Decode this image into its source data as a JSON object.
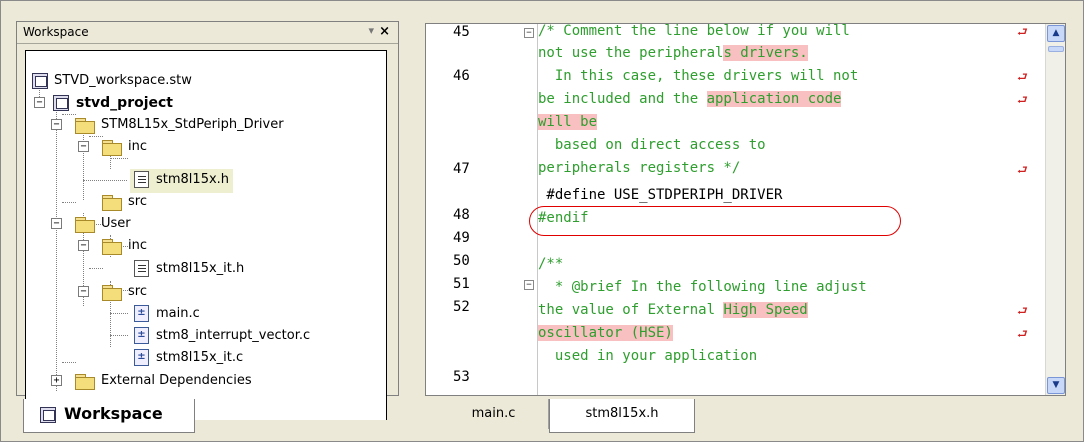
{
  "workspace_panel": {
    "title": "Workspace",
    "pin_glyph": "▾",
    "close_glyph": "×",
    "tab_label": "Workspace",
    "tree": {
      "workspace_file": "STVD_workspace.stw",
      "project": "stvd_project",
      "driver_folder": "STM8L15x_StdPeriph_Driver",
      "driver_inc": "inc",
      "driver_header": "stm8l15x.h",
      "driver_src": "src",
      "user_folder": "User",
      "user_inc": "inc",
      "user_header": "stm8l15x_it.h",
      "user_src": "src",
      "user_files": [
        "main.c",
        "stm8_interrupt_vector.c",
        "stm8l15x_it.c"
      ],
      "external_dependencies": "External Dependencies"
    }
  },
  "editor": {
    "line_numbers": [
      "45",
      "46",
      "47",
      "48",
      "49",
      "50",
      "51",
      "52",
      "53"
    ],
    "code": {
      "l45a_pre": "/* Comment the line below if you will",
      "l45b_pre": "not use the peripheral",
      "l45b_hl": "s drivers.",
      "l46a": "  In this case, these drivers will not",
      "l46b_pre": "be included and the ",
      "l46b_hl": "application code",
      "l46c_hl": "will be",
      "l47a": "  based on direct access to",
      "l47b": "peripherals registers */",
      "l48": " #define USE_STDPERIPH_DRIVER",
      "l49": "#endif",
      "l51": "/**",
      "l52a": "  * @brief In the following line adjust",
      "l52b_pre": "the value of External ",
      "l52b_hl": "High Speed",
      "l52c_hl": "oscillator (HSE)",
      "l53": "  used in your application"
    },
    "wrap_glyph": "⮐",
    "tabs": [
      "main.c",
      "stm8l15x.h"
    ],
    "active_tab": "stm8l15x.h"
  },
  "colors": {
    "comment": "#2e9e2e",
    "highlight": "#f8c0c0",
    "annotation_oval": "#e00000",
    "wrap_marker": "#d02020"
  }
}
